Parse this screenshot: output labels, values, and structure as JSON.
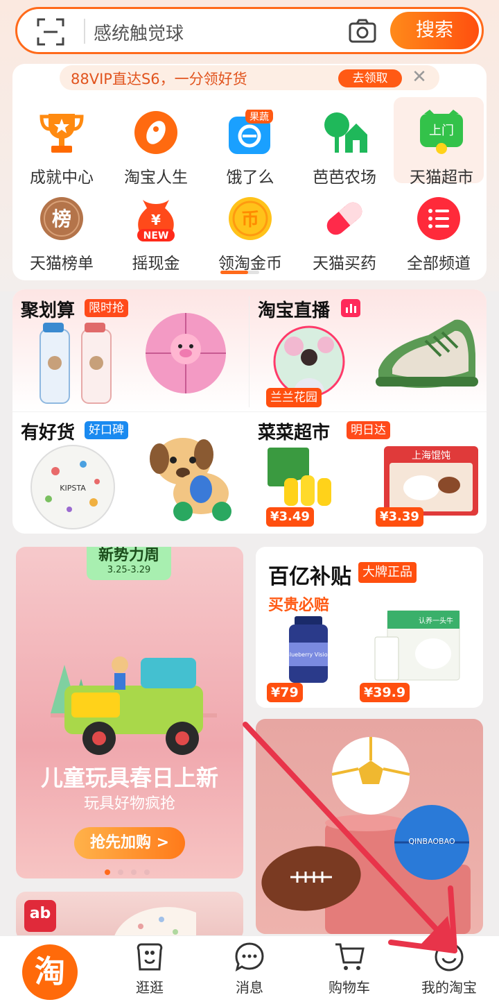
{
  "search": {
    "placeholder": "感统触觉球",
    "button_label": "搜索"
  },
  "vip_banner": {
    "text": "88VIP直达S6，一分领好货",
    "button_label": "去领取"
  },
  "channels": [
    {
      "label": "成就中心",
      "icon": "trophy-icon"
    },
    {
      "label": "淘宝人生",
      "icon": "taobao-life-icon"
    },
    {
      "label": "饿了么",
      "icon": "eleme-icon",
      "badge": "果蔬"
    },
    {
      "label": "芭芭农场",
      "icon": "farm-icon"
    },
    {
      "label": "天猫超市",
      "icon": "tmall-supermarket-icon",
      "badge": "上门"
    },
    {
      "label": "天猫榜单",
      "icon": "ranking-icon",
      "glyph": "榜"
    },
    {
      "label": "摇现金",
      "icon": "cash-bag-icon",
      "badge": "NEW",
      "glyph": "¥"
    },
    {
      "label": "领淘金币",
      "icon": "gold-coin-icon",
      "glyph": "币"
    },
    {
      "label": "天猫买药",
      "icon": "pill-icon"
    },
    {
      "label": "全部频道",
      "icon": "all-channels-icon"
    }
  ],
  "grid": {
    "juhuasuan": {
      "title": "聚划算",
      "tag": "限时抢"
    },
    "live": {
      "title": "淘宝直播",
      "anchor": "兰兰花园"
    },
    "haohuo": {
      "title": "有好货",
      "tag": "好口碑",
      "ball_text": "KIPSTA"
    },
    "caicai": {
      "title": "菜菜超市",
      "tag": "明日达",
      "prices": [
        "¥3.49",
        "¥3.39"
      ],
      "dumpling_text": "上海馄饨"
    }
  },
  "promo": {
    "tag_title": "新势力周",
    "tag_dates": "3.25-3.29",
    "headline": "儿童玩具春日上新",
    "subline": "玩具好物疯抢",
    "button": "抢先加购 >",
    "product_text": "Blueberry Vision"
  },
  "subsidy": {
    "title": "百亿补贴",
    "tag": "大牌正品",
    "subtitle": "买贵必赔",
    "prices": [
      "¥79",
      "¥39.9"
    ],
    "milk_text": "认养一头牛"
  },
  "balls_card": {
    "ball_text": "QINBAOBAO"
  },
  "small_card": {
    "logo_text": "ab"
  },
  "nav": [
    {
      "label": "淘",
      "icon": "taobao-home-icon"
    },
    {
      "label": "逛逛",
      "icon": "browse-icon"
    },
    {
      "label": "消息",
      "icon": "message-icon"
    },
    {
      "label": "购物车",
      "icon": "cart-icon"
    },
    {
      "label": "我的淘宝",
      "icon": "my-taobao-icon"
    }
  ],
  "colors": {
    "accent": "#ff6a1a",
    "annotation_arrow": "#e8344a"
  }
}
